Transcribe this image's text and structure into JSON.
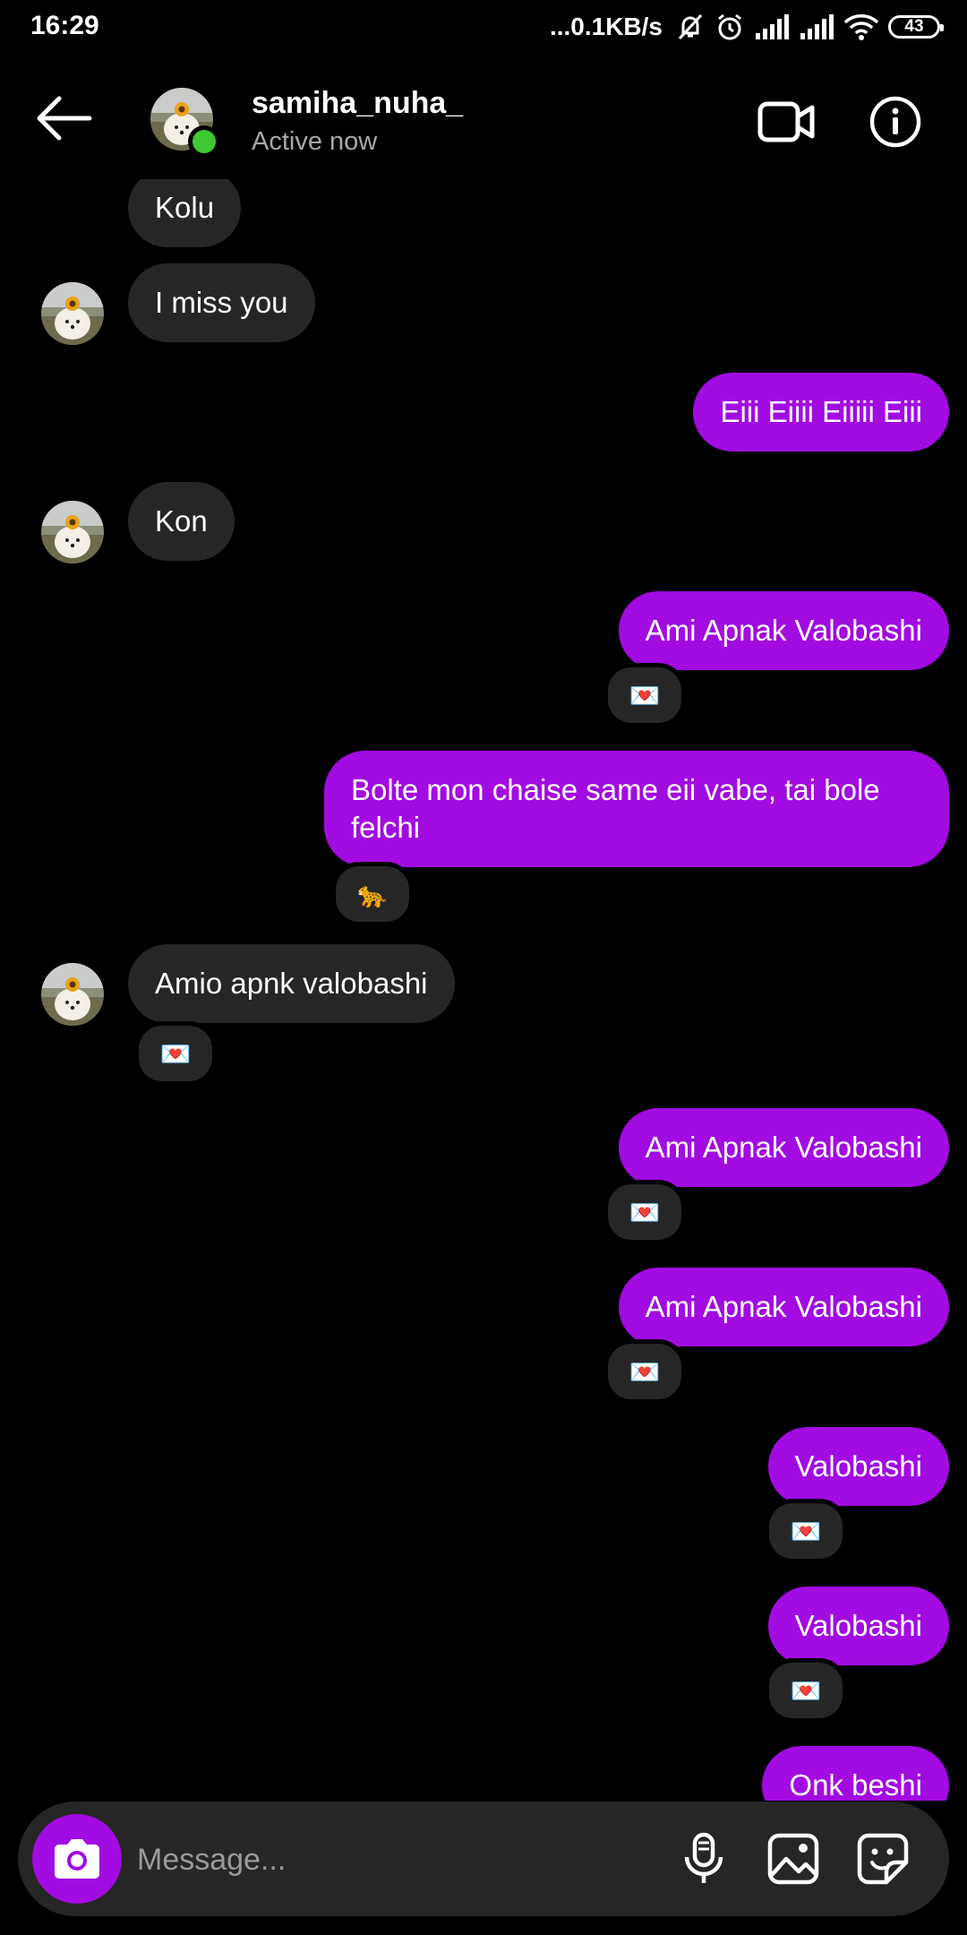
{
  "status_bar": {
    "time": "16:29",
    "network_speed": "...0.1KB/s",
    "battery": "43",
    "icons": [
      "mute-icon",
      "alarm-icon",
      "signal-icon",
      "signal-icon",
      "wifi-icon"
    ]
  },
  "header": {
    "contact_name": "samiha_nuha_",
    "status": "Active now",
    "icons": [
      "back-arrow-icon",
      "video-call-icon",
      "info-icon"
    ]
  },
  "messages": [
    {
      "dir": "in",
      "text": "Kolu"
    },
    {
      "dir": "in",
      "text": "I miss you"
    },
    {
      "dir": "out",
      "text": "Eiii Eiiii Eiiiii Eiii"
    },
    {
      "dir": "in",
      "text": "Kon"
    },
    {
      "dir": "out",
      "text": "Ami Apnak Valobashi",
      "reaction": "💌"
    },
    {
      "dir": "out",
      "text": "Bolte mon chaise same eii vabe, tai bole felchi",
      "reaction": "🐆"
    },
    {
      "dir": "in",
      "text": "Amio apnk valobashi",
      "reaction": "💌"
    },
    {
      "dir": "out",
      "text": "Ami Apnak Valobashi",
      "reaction": "💌"
    },
    {
      "dir": "out",
      "text": "Ami Apnak Valobashi",
      "reaction": "💌"
    },
    {
      "dir": "out",
      "text": "Valobashi",
      "reaction": "💌"
    },
    {
      "dir": "out",
      "text": "Valobashi",
      "reaction": "💌"
    },
    {
      "dir": "out",
      "text": "Onk beshi"
    }
  ],
  "composer": {
    "placeholder": "Message...",
    "icons": [
      "camera-icon",
      "microphone-icon",
      "gallery-icon",
      "sticker-icon"
    ]
  },
  "colors": {
    "background": "#000000",
    "incoming_bubble": "#262626",
    "outgoing_bubble": "#a20be2",
    "online": "#3ec832"
  }
}
